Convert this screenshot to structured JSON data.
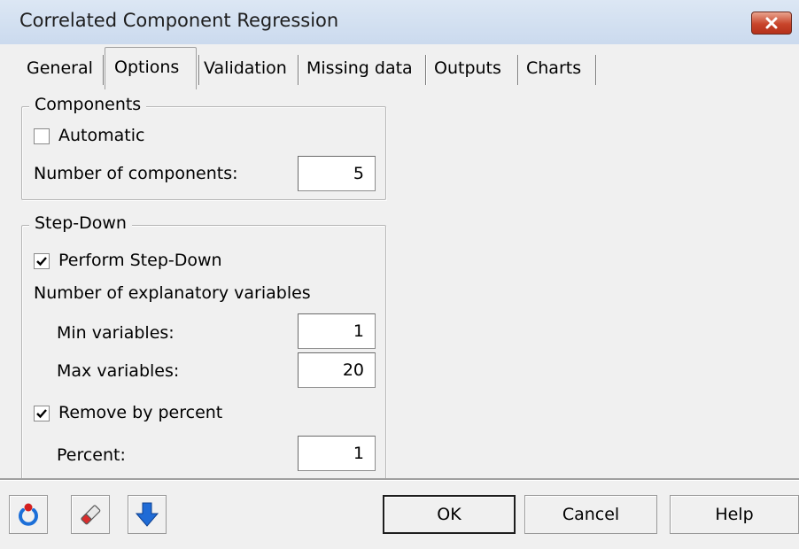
{
  "window": {
    "title": "Correlated Component Regression"
  },
  "tabs": [
    {
      "label": "General"
    },
    {
      "label": "Options"
    },
    {
      "label": "Validation"
    },
    {
      "label": "Missing data"
    },
    {
      "label": "Outputs"
    },
    {
      "label": "Charts"
    }
  ],
  "components": {
    "legend": "Components",
    "automatic_label": "Automatic",
    "automatic_checked": false,
    "num_components_label": "Number of components:",
    "num_components_value": "5"
  },
  "stepdown": {
    "legend": "Step-Down",
    "perform_label": "Perform Step-Down",
    "perform_checked": true,
    "explanatory_label": "Number of explanatory variables",
    "min_label": "Min variables:",
    "min_value": "1",
    "max_label": "Max variables:",
    "max_value": "20",
    "remove_label": "Remove by percent",
    "remove_checked": true,
    "percent_label": "Percent:",
    "percent_value": "1"
  },
  "footer": {
    "icons": [
      "reload-icon",
      "eraser-icon",
      "down-arrow-icon"
    ],
    "ok_label": "OK",
    "cancel_label": "Cancel",
    "help_label": "Help"
  },
  "colors": {
    "close_button": "#c8442a",
    "reload_blue": "#1c6fd8",
    "reload_red": "#d32020",
    "arrow_blue": "#1f6bd6"
  }
}
